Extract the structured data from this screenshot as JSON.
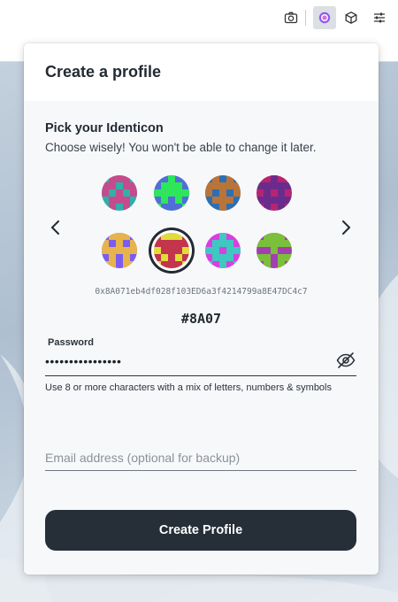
{
  "popup": {
    "title": "Create a profile",
    "section_title": "Pick your Identicon",
    "section_subtitle": "Choose wisely! You won't be able to change it later.",
    "address": "0x8A071eb4df028f103ED6a3f4214799a8E47DC4c7",
    "short_address": "#8A07",
    "password": {
      "label": "Password",
      "value": "••••••••••••••••"
    },
    "password_hint": "Use 8 or more characters with a mix of letters, numbers & symbols",
    "email": {
      "placeholder": "Email address (optional for backup)",
      "value": ""
    },
    "create_button": "Create Profile"
  },
  "identicons": [
    {
      "selected": false,
      "bg": "#2fb0a8",
      "fg": "#c54b8c"
    },
    {
      "selected": false,
      "bg": "#4f6fd6",
      "fg": "#2ee65a"
    },
    {
      "selected": false,
      "bg": "#2c6fb3",
      "fg": "#b9743a"
    },
    {
      "selected": false,
      "bg": "#b8246f",
      "fg": "#6a2c8c"
    },
    {
      "selected": false,
      "bg": "#7b5cf0",
      "fg": "#e6b44a"
    },
    {
      "selected": true,
      "bg": "#e0dc3a",
      "fg": "#c3344d"
    },
    {
      "selected": false,
      "bg": "#d83fe0",
      "fg": "#3fc7c2"
    },
    {
      "selected": false,
      "bg": "#a23fb0",
      "fg": "#7bbf3a"
    }
  ],
  "icons": {
    "toolbar": [
      "camera-icon",
      "extension-icon",
      "cube-icon",
      "sliders-icon"
    ],
    "nav": [
      "chevron-left-icon",
      "chevron-right-icon"
    ],
    "eye": "eye-off-icon"
  },
  "colors": {
    "accent": "#262f38",
    "text": "#222a33"
  }
}
